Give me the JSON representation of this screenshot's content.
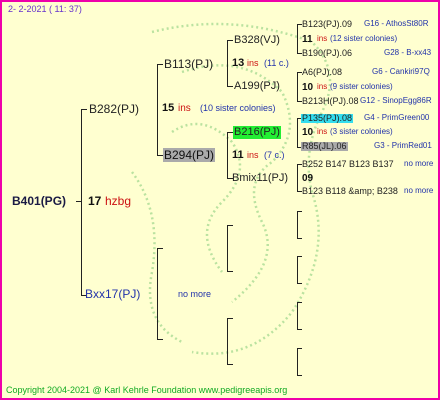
{
  "header": {
    "date": "2-  2-2021 ( 11: 37)"
  },
  "footer": {
    "copyright": "Copyright 2004-2021 @ Karl Kehrle Foundation   www.pedigreeapis.org"
  },
  "root": {
    "name": "B401(PG)",
    "num": "17",
    "code": "hzbg"
  },
  "gen1": {
    "top": {
      "name": "B282(PJ)",
      "num": "15",
      "ins": "ins",
      "colonies": "(10 sister colonies)"
    },
    "bottom": {
      "name": "Bxx17(PJ)",
      "no_more": "no more"
    }
  },
  "gen2": {
    "a": {
      "name": "B113(PJ)",
      "num": "13",
      "ins": "ins",
      "c": "(11 c.)"
    },
    "b": {
      "name": "B294(PJ)",
      "num": "11",
      "ins": "ins",
      "c": "(7 c.)"
    }
  },
  "gen3": {
    "a1": {
      "name": "B328(VJ)"
    },
    "a2": {
      "name": "A199(PJ)"
    },
    "b1": {
      "name": "B216(PJ)"
    },
    "b2": {
      "name": "Bmix11(PJ)"
    }
  },
  "gen4": {
    "r1": {
      "name": "B123(PJ).09",
      "tag": "G16 - AthosSt80R",
      "num": "11",
      "ins": "ins",
      "colonies": "(12 sister colonies)"
    },
    "r2": {
      "name": "B190(PJ).06",
      "tag": "G28 - B-xx43"
    },
    "r3": {
      "name": "A6(PJ).08",
      "tag": "G6 - Cankiri97Q",
      "num": "10",
      "ins": "ins",
      "colonies": "(9 sister colonies)"
    },
    "r4": {
      "name": "B213H(PJ).08",
      "tag": "G12 - SinopEgg86R"
    },
    "r5": {
      "name": "P135(PJ).08",
      "tag": "G4 - PrimGreen00",
      "num": "10",
      "ins": "ins",
      "colonies": "(3 sister colonies)"
    },
    "r6": {
      "name": "R85(JL).06",
      "tag": "G3 - PrimRed01"
    },
    "r7": {
      "line": "B252 B147 B123 B137",
      "no_more": "no more",
      "num": "09"
    },
    "r8": {
      "line": "B123 B118 &amp; B238",
      "no_more": "no more"
    }
  }
}
